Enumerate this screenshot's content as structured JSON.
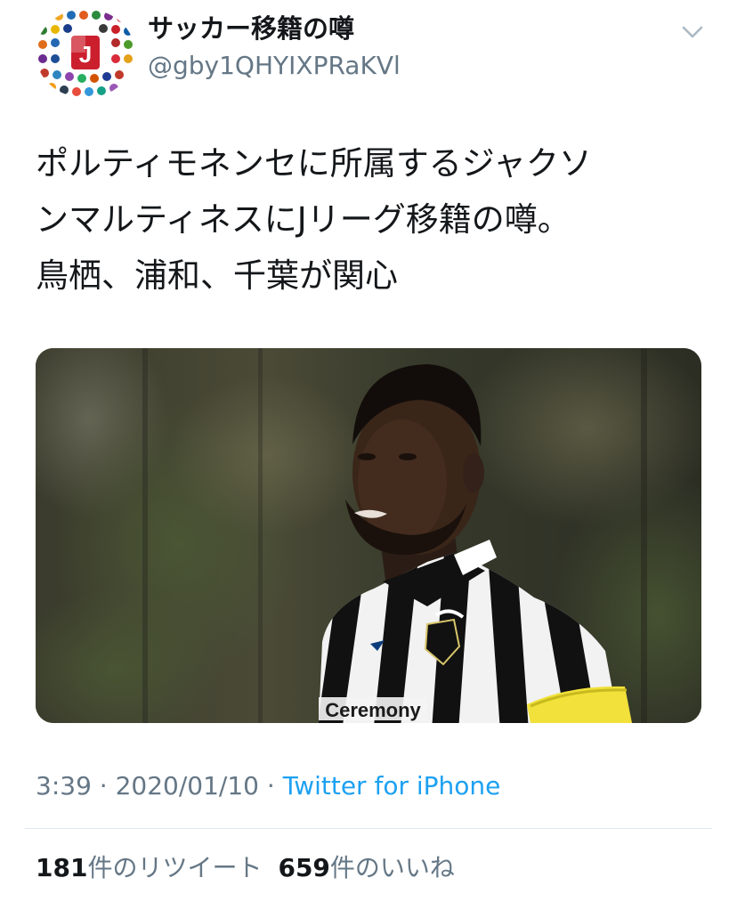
{
  "tweet": {
    "display_name": "サッカー移籍の噂",
    "handle": "@gby1QHYIXPRaKVl",
    "text": "ポルティモネンセに所属するジャクソ\nンマルティネスにJリーグ移籍の噂。\n鳥栖、浦和、千葉が関心",
    "time": "3:39",
    "separator": "·",
    "date": "2020/01/10",
    "source": "Twitter for iPhone",
    "retweet_count": "181",
    "retweet_label": "件のリツイート",
    "like_count": "659",
    "like_label": "件のいいね"
  },
  "media": {
    "jersey_text": "Ceremony"
  },
  "icons": {
    "avatar": "j-league-club-crests-avatar",
    "menu": "chevron-down-icon"
  },
  "colors": {
    "text": "#14171a",
    "secondary": "#657786",
    "link": "#1da1f2",
    "divider": "#e1e8ed"
  }
}
